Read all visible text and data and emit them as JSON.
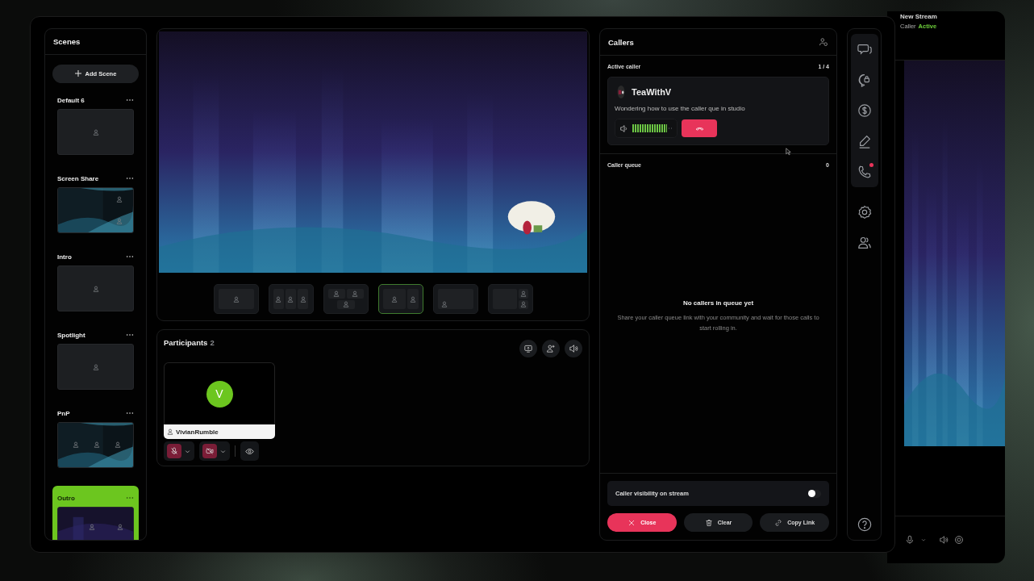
{
  "scenes_panel": {
    "title": "Scenes",
    "add_button": "Add Scene",
    "scenes": [
      {
        "name": "Default 6",
        "selected": false,
        "kind": "single"
      },
      {
        "name": "Screen Share",
        "selected": false,
        "kind": "screen-share"
      },
      {
        "name": "Intro",
        "selected": false,
        "kind": "single"
      },
      {
        "name": "Spotlight",
        "selected": false,
        "kind": "single"
      },
      {
        "name": "PnP",
        "selected": false,
        "kind": "trio"
      },
      {
        "name": "Outro",
        "selected": true,
        "kind": "outro"
      }
    ]
  },
  "preview": {
    "layouts": [
      {
        "kind": "solo",
        "selected": false
      },
      {
        "kind": "row-of-three",
        "selected": false
      },
      {
        "kind": "two-over-one",
        "selected": false
      },
      {
        "kind": "main-and-side",
        "selected": true
      },
      {
        "kind": "picture-in-picture",
        "selected": false
      },
      {
        "kind": "main-and-pair",
        "selected": false
      }
    ]
  },
  "participants": {
    "title": "Participants",
    "count": "2",
    "actions": [
      {
        "kind": "screen-share"
      },
      {
        "kind": "add-person"
      },
      {
        "kind": "speaker"
      }
    ],
    "people": [
      {
        "name": "VivianRumble",
        "initial": "V",
        "mic_muted": true,
        "camera_off": true
      }
    ]
  },
  "callers": {
    "title": "Callers",
    "active_label": "Active caller",
    "position": "1 / 4",
    "active_caller": {
      "name": "TeaWithV",
      "message": "Wondering how to use the caller que in studio",
      "level": 0.85
    },
    "queue_label": "Caller queue",
    "queue_count": "0",
    "empty_title": "No callers in queue yet",
    "empty_text": "Share your caller queue link with your community and wait for those calls to start rolling in.",
    "visibility": {
      "label": "Caller visibility on stream",
      "on": false
    },
    "buttons": [
      {
        "kind": "close",
        "label": "Close"
      },
      {
        "kind": "clear",
        "label": "Clear"
      },
      {
        "kind": "copy-link",
        "label": "Copy Link"
      }
    ]
  },
  "rail": {
    "top": [
      {
        "kind": "chat",
        "badge": false
      },
      {
        "kind": "private-chat",
        "badge": false
      },
      {
        "kind": "tips",
        "badge": false
      },
      {
        "kind": "edit",
        "badge": false
      },
      {
        "kind": "phone",
        "badge": true
      }
    ],
    "bottom": [
      {
        "kind": "settings",
        "badge": false
      },
      {
        "kind": "people",
        "badge": false
      }
    ],
    "footer": [
      {
        "kind": "help",
        "badge": false
      }
    ]
  },
  "back_window": {
    "title": "New Stream",
    "caller_label": "Caller",
    "caller_status": "Active",
    "controls": [
      {
        "kind": "mic"
      },
      {
        "kind": "speaker"
      },
      {
        "kind": "settings"
      }
    ]
  }
}
